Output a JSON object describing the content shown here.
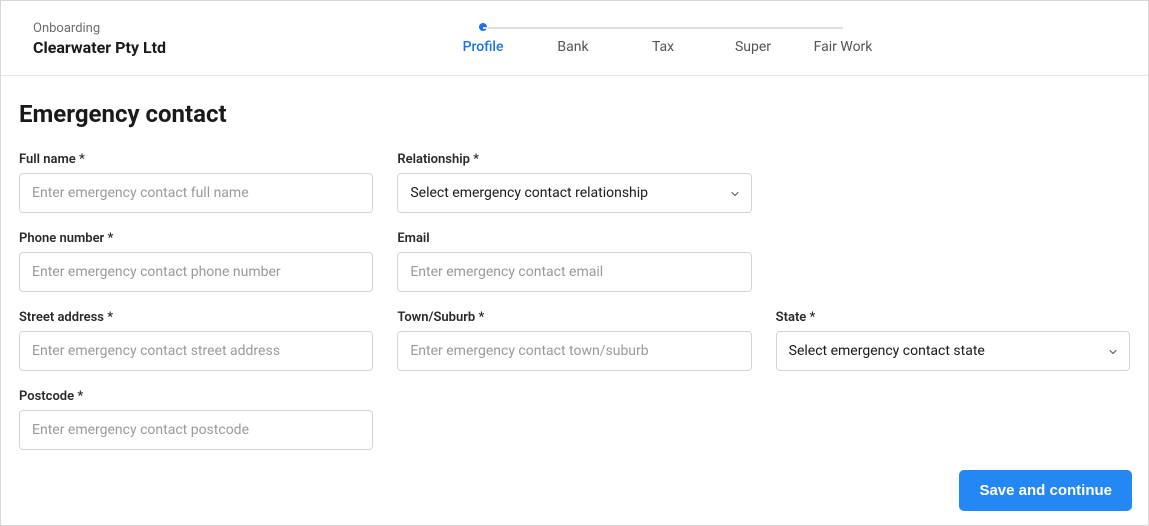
{
  "header": {
    "breadcrumb": "Onboarding",
    "company": "Clearwater Pty Ltd",
    "tabs": [
      {
        "label": "Profile",
        "active": true
      },
      {
        "label": "Bank",
        "active": false
      },
      {
        "label": "Tax",
        "active": false
      },
      {
        "label": "Super",
        "active": false
      },
      {
        "label": "Fair Work",
        "active": false
      }
    ]
  },
  "page": {
    "title": "Emergency contact"
  },
  "fields": {
    "full_name": {
      "label": "Full name *",
      "placeholder": "Enter emergency contact full name",
      "value": ""
    },
    "relationship": {
      "label": "Relationship *",
      "placeholder": "Select emergency contact relationship",
      "value": ""
    },
    "phone": {
      "label": "Phone number *",
      "placeholder": "Enter emergency contact phone number",
      "value": ""
    },
    "email": {
      "label": "Email",
      "placeholder": "Enter emergency contact email",
      "value": ""
    },
    "street": {
      "label": "Street address *",
      "placeholder": "Enter emergency contact street address",
      "value": ""
    },
    "town": {
      "label": "Town/Suburb *",
      "placeholder": "Enter emergency contact town/suburb",
      "value": ""
    },
    "state": {
      "label": "State *",
      "placeholder": "Select emergency contact state",
      "value": ""
    },
    "postcode": {
      "label": "Postcode *",
      "placeholder": "Enter emergency contact postcode",
      "value": ""
    }
  },
  "actions": {
    "save_continue": "Save and continue"
  }
}
